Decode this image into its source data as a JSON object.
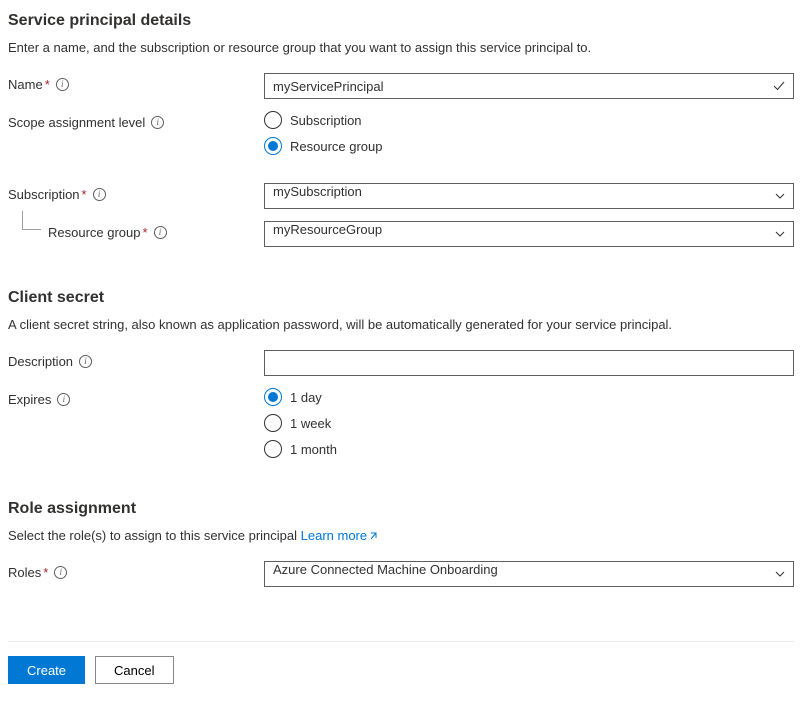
{
  "sections": {
    "details": {
      "heading": "Service principal details",
      "intro": "Enter a name, and the subscription or resource group that you want to assign this service principal to."
    },
    "secret": {
      "heading": "Client secret",
      "intro": "A client secret string, also known as application password, will be automatically generated for your service principal."
    },
    "role": {
      "heading": "Role assignment",
      "intro_prefix": "Select the role(s) to assign to this service principal ",
      "learn_more": "Learn more"
    }
  },
  "labels": {
    "name": "Name",
    "scope": "Scope assignment level",
    "subscription": "Subscription",
    "resource_group": "Resource group",
    "description": "Description",
    "expires": "Expires",
    "roles": "Roles"
  },
  "values": {
    "name": "myServicePrincipal",
    "subscription": "mySubscription",
    "resource_group": "myResourceGroup",
    "description": "",
    "roles": "Azure Connected Machine Onboarding"
  },
  "scope_options": {
    "subscription": "Subscription",
    "resource_group": "Resource group",
    "selected": "resource_group"
  },
  "expires_options": {
    "one_day": "1 day",
    "one_week": "1 week",
    "one_month": "1 month",
    "selected": "one_day"
  },
  "buttons": {
    "create": "Create",
    "cancel": "Cancel"
  }
}
